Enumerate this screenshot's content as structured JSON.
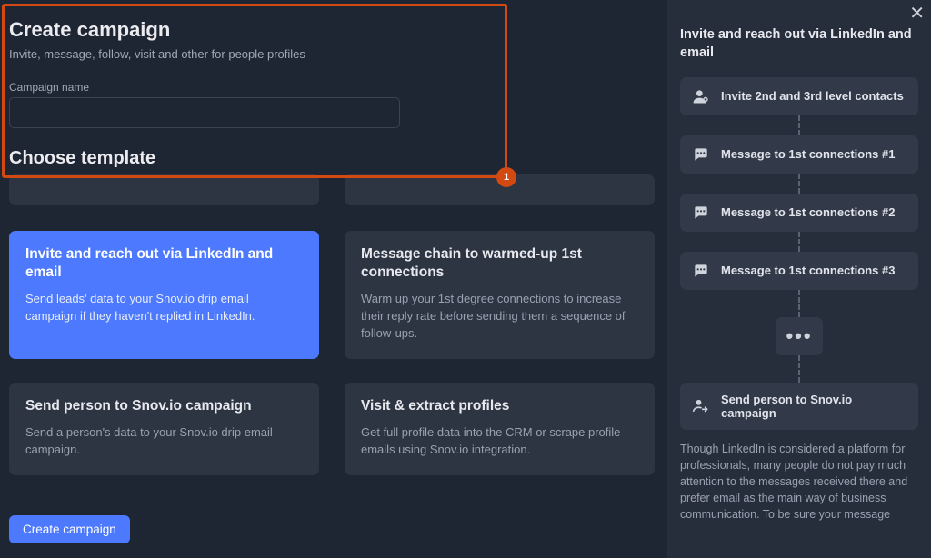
{
  "header": {
    "title": "Create campaign",
    "subtitle": "Invite, message, follow, visit and other for people profiles",
    "field_label": "Campaign name",
    "input_value": "",
    "section_title": "Choose template"
  },
  "highlight_badge": "1",
  "templates": [
    {
      "title": "Invite and reach out via LinkedIn and email",
      "desc": "Send leads' data to your Snov.io drip email campaign if they haven't replied in LinkedIn.",
      "active": true
    },
    {
      "title": "Message chain to warmed-up 1st connections",
      "desc": "Warm up your 1st degree connections to increase their reply rate before sending them a sequence of follow-ups.",
      "active": false
    },
    {
      "title": "Send person to Snov.io campaign",
      "desc": "Send a person's data to your Snov.io drip email campaign.",
      "active": false
    },
    {
      "title": "Visit & extract profiles",
      "desc": "Get full profile data into the CRM or scrape profile emails using Snov.io integration.",
      "active": false
    }
  ],
  "footer": {
    "cta": "Create campaign"
  },
  "right": {
    "title": "Invite and reach out via LinkedIn and email",
    "steps": [
      {
        "icon": "invite",
        "label": "Invite 2nd and 3rd level contacts"
      },
      {
        "icon": "message",
        "label": "Message to 1st connections #1"
      },
      {
        "icon": "message",
        "label": "Message to 1st connections #2"
      },
      {
        "icon": "message",
        "label": "Message to 1st connections #3"
      }
    ],
    "final_step": {
      "icon": "send",
      "label": "Send person to Snov.io campaign"
    },
    "note": "Though LinkedIn is considered a platform for professionals, many people do not pay much attention to the messages received there and prefer email as the main way of business communication. To be sure your message"
  }
}
